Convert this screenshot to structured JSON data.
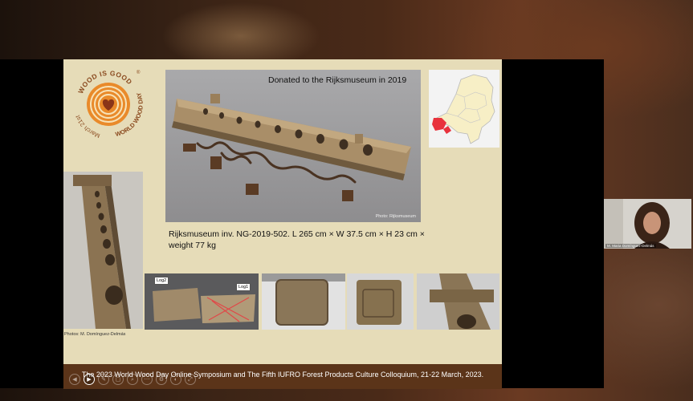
{
  "slide": {
    "logo": {
      "top_text": "WOOD IS GOOD",
      "registered_mark": "®",
      "left_text": "March 21st",
      "right_text": "WORLD WOOD DAY"
    },
    "main_photo": {
      "caption": "Donated to the Rijksmuseum in 2019",
      "credit": "Photo: Rijksmuseum"
    },
    "description": "Rijksmuseum inv. NG-2019-502. L 265 cm × W 37.5 cm × H 23 cm × weight 77 kg",
    "photos_credit": "Photos: M. Domínguez-Delmás",
    "thumbnails": {
      "log2_label": "Log2",
      "log1_label": "Log1"
    }
  },
  "footer": {
    "text": "The 2023 World Wood Day Online Symposium and The Fifth IUFRO Forest Products Culture Colloquium, 21-22 March, 2023."
  },
  "controls": {
    "prev": "◀",
    "play": "▶",
    "items": [
      "✎",
      "▢",
      "⌕",
      "⋯",
      "⚙",
      "◐",
      "⤢"
    ]
  },
  "participant": {
    "name": "M. Maria Domínguez-Delmás"
  },
  "colors": {
    "slide_bg": "#e6dcb8",
    "footer_bg": "#5b3419",
    "logo_brown": "#8a4a1f",
    "logo_orange": "#e98a2a",
    "map_highlight": "#e8323c"
  }
}
